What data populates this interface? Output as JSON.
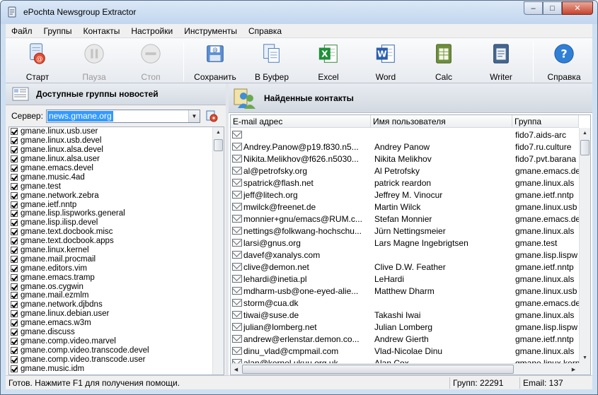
{
  "window": {
    "title": "ePochta Newsgroup Extractor",
    "controls": {
      "minimize": "–",
      "maximize": "□",
      "close": "✕"
    }
  },
  "menu": [
    "Файл",
    "Группы",
    "Контакты",
    "Настройки",
    "Инструменты",
    "Справка"
  ],
  "toolbar": {
    "start": "Старт",
    "pause": "Пауза",
    "stop": "Стоп",
    "save": "Сохранить",
    "clipboard": "В Буфер",
    "excel": "Excel",
    "word": "Word",
    "calc": "Calc",
    "writer": "Writer",
    "help": "Справка"
  },
  "left": {
    "title": "Доступные группы новостей",
    "server_label": "Сервер:",
    "server_value": "news.gmane.org",
    "groups": [
      "gmane.linux.usb.user",
      "gmane.linux.usb.devel",
      "gmane.linux.alsa.devel",
      "gmane.linux.alsa.user",
      "gmane.emacs.devel",
      "gmane.music.4ad",
      "gmane.test",
      "gmane.network.zebra",
      "gmane.ietf.nntp",
      "gmane.lisp.lispworks.general",
      "gmane.lisp.ilisp.devel",
      "gmane.text.docbook.misc",
      "gmane.text.docbook.apps",
      "gmane.linux.kernel",
      "gmane.mail.procmail",
      "gmane.editors.vim",
      "gmane.emacs.tramp",
      "gmane.os.cygwin",
      "gmane.mail.ezmlm",
      "gmane.network.djbdns",
      "gmane.linux.debian.user",
      "gmane.emacs.w3m",
      "gmane.discuss",
      "gmane.comp.video.marvel",
      "gmane.comp.video.transcode.devel",
      "gmane.comp.video.transcode.user",
      "gmane.music.idm"
    ]
  },
  "right": {
    "title": "Найденные контакты",
    "columns": [
      "E-mail адрес",
      "Имя пользователя",
      "Группа"
    ],
    "rows": [
      [
        "",
        "",
        "fido7.aids-arc"
      ],
      [
        "Andrey.Panow@p19.f830.n5...",
        "Andrey Panow",
        "fido7.ru.culture"
      ],
      [
        "Nikita.Melikhov@f626.n5030...",
        "Nikita Melikhov",
        "fido7.pvt.barana"
      ],
      [
        "al@petrofsky.org",
        "Al Petrofsky",
        "gmane.emacs.de"
      ],
      [
        "spatrick@flash.net",
        "patrick reardon",
        "gmane.linux.als"
      ],
      [
        "jeff@litech.org",
        "Jeffrey M. Vinocur",
        "gmane.ietf.nntp"
      ],
      [
        "mwilck@freenet.de",
        "Martin Wilck",
        "gmane.linux.usb"
      ],
      [
        "monnier+gnu/emacs@RUM.c...",
        "Stefan Monnier",
        "gmane.emacs.de"
      ],
      [
        "nettings@folkwang-hochschu...",
        "Jürn Nettingsmeier",
        "gmane.linux.als"
      ],
      [
        "larsi@gnus.org",
        "Lars Magne Ingebrigtsen",
        "gmane.test"
      ],
      [
        "davef@xanalys.com",
        "",
        "gmane.lisp.lispw"
      ],
      [
        "clive@demon.net",
        "Clive D.W. Feather",
        "gmane.ietf.nntp"
      ],
      [
        "lehardi@inetia.pl",
        "LeHardi",
        "gmane.linux.als"
      ],
      [
        "mdharm-usb@one-eyed-alie...",
        "Matthew Dharm",
        "gmane.linux.usb"
      ],
      [
        "storm@cua.dk",
        "",
        "gmane.emacs.de"
      ],
      [
        "tiwai@suse.de",
        "Takashi Iwai",
        "gmane.linux.als"
      ],
      [
        "julian@lomberg.net",
        "Julian Lomberg",
        "gmane.lisp.lispw"
      ],
      [
        "andrew@erlenstar.demon.co...",
        "Andrew Gierth",
        "gmane.ietf.nntp"
      ],
      [
        "dinu_vlad@cmpmail.com",
        "Vlad-Nicolae Dinu",
        "gmane.linux.als"
      ],
      [
        "alan@kernel.ukuu.org.uk",
        "Alan Cox",
        "gmane.linux.kern"
      ]
    ]
  },
  "status": {
    "message": "Готов. Нажмите F1 для получения помощи.",
    "groups": "Групп: 22291",
    "emails": "Email: 137"
  }
}
